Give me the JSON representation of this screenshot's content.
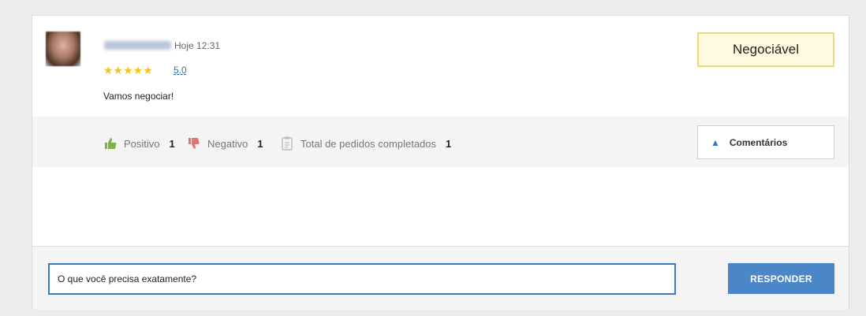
{
  "review": {
    "time": "Hoje 12:31",
    "stars": "★★★★★",
    "rating": "5.0",
    "message": "Vamos negociar!",
    "badge": "Negociável"
  },
  "stats": {
    "positive_label": "Positivo",
    "positive_count": "1",
    "negative_label": "Negativo",
    "negative_count": "1",
    "orders_label": "Total de pedidos completados",
    "orders_count": "1"
  },
  "comments_button": "Comentários",
  "reply": {
    "input_value": "O que você precisa exatamente?",
    "button_label": "RESPONDER"
  },
  "colors": {
    "accent": "#4a86c8",
    "star": "#f5c518",
    "thumb_up": "#7cb342",
    "thumb_down": "#e57373"
  }
}
